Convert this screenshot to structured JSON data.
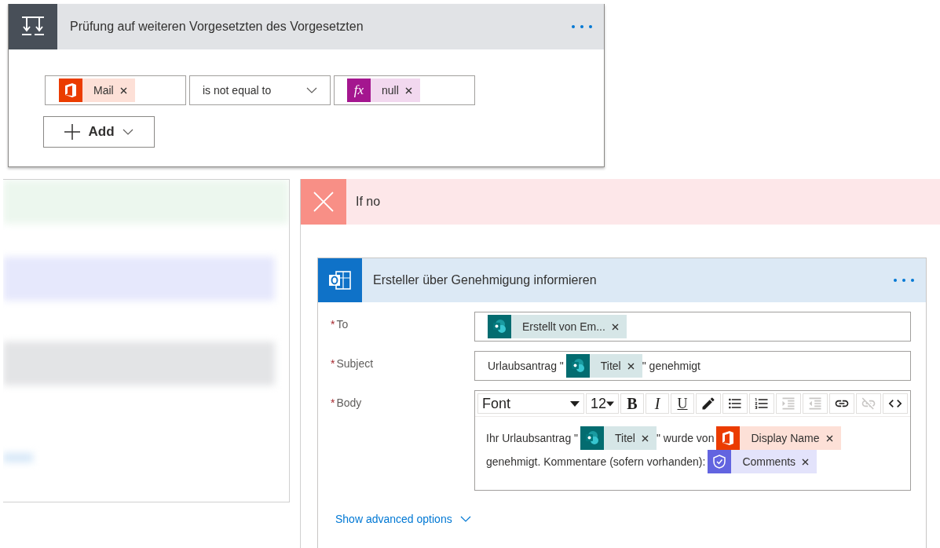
{
  "condition": {
    "title": "Prüfung auf weiteren Vorgesetzten des Vorgesetzten",
    "rows": [
      {
        "left": {
          "kind": "office",
          "label": "Mail"
        },
        "operator": "is not equal to",
        "right": {
          "kind": "expression",
          "icon_text": "fx",
          "label": "null"
        }
      }
    ],
    "add_button": "Add"
  },
  "if_no": {
    "title": "If no",
    "action": {
      "title": "Ersteller über Genehmigung informieren",
      "fields": [
        {
          "kind": "line",
          "required_mark": "*",
          "label": "To",
          "lines": [
            [
              {
                "kind": "sharepoint",
                "label": "Erstellt von Em..."
              }
            ]
          ]
        },
        {
          "kind": "line",
          "required_mark": "*",
          "label": "Subject",
          "lines": [
            [
              {
                "kind": "text",
                "text": "Urlaubsantrag \""
              },
              {
                "kind": "sharepoint",
                "label": "Titel"
              },
              {
                "kind": "text",
                "text": "\" genehmigt"
              }
            ]
          ]
        },
        {
          "kind": "editor",
          "required_mark": "*",
          "label": "Body",
          "toolbar": [
            {
              "kind": "font",
              "label": "Font",
              "disabled": false
            },
            {
              "kind": "size",
              "label": "12",
              "disabled": false
            },
            {
              "kind": "bold",
              "label": "B",
              "disabled": false
            },
            {
              "kind": "italic",
              "label": "I",
              "disabled": false
            },
            {
              "kind": "underline",
              "label": "U",
              "disabled": false
            },
            {
              "kind": "pen",
              "disabled": false
            },
            {
              "kind": "bullets",
              "disabled": false
            },
            {
              "kind": "numbers",
              "disabled": false
            },
            {
              "kind": "indent",
              "disabled": true
            },
            {
              "kind": "outdent",
              "disabled": true
            },
            {
              "kind": "link",
              "disabled": false
            },
            {
              "kind": "unlink",
              "disabled": true
            },
            {
              "kind": "code",
              "disabled": false
            }
          ],
          "lines": [
            [
              {
                "kind": "text",
                "text": "Ihr Urlaubsantrag \""
              },
              {
                "kind": "sharepoint",
                "label": "Titel"
              },
              {
                "kind": "text",
                "text": "\" wurde von"
              },
              {
                "kind": "office",
                "label": "Display Name"
              }
            ],
            [
              {
                "kind": "text",
                "text": "genehmigt. Kommentare (sofern vorhanden):"
              },
              {
                "kind": "approval",
                "label": "Comments"
              }
            ]
          ]
        }
      ],
      "advanced_link": "Show advanced options"
    }
  }
}
